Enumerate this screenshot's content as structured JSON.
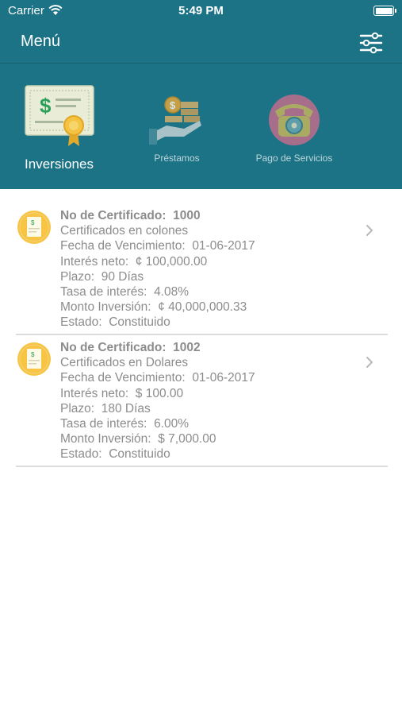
{
  "status_bar": {
    "carrier": "Carrier",
    "time": "5:49 PM"
  },
  "nav": {
    "title": "Menú"
  },
  "tabs": [
    {
      "label": "Inversiones",
      "icon": "certificate-icon",
      "active": true
    },
    {
      "label": "Préstamos",
      "icon": "money-hand-icon",
      "active": false
    },
    {
      "label": "Pago de Servicios",
      "icon": "telephone-icon",
      "active": false
    }
  ],
  "certificates": [
    {
      "number_label": "No de Certificado:",
      "number": "1000",
      "type": "Certificados en colones",
      "due_label": "Fecha de Vencimiento:",
      "due": "01-06-2017",
      "interest_label": "Interés neto:",
      "interest": "¢ 100,000.00",
      "term_label": "Plazo:",
      "term": "90  Días",
      "rate_label": "Tasa de interés:",
      "rate": "4.08%",
      "amount_label": "Monto Inversión:",
      "amount": "¢ 40,000,000.33",
      "status_label": "Estado:",
      "status": "Constituido"
    },
    {
      "number_label": "No de Certificado:",
      "number": "1002",
      "type": "Certificados en Dolares",
      "due_label": "Fecha de Vencimiento:",
      "due": "01-06-2017",
      "interest_label": "Interés neto:",
      "interest": "$ 100.00",
      "term_label": "Plazo:",
      "term": "180  Días",
      "rate_label": "Tasa de interés:",
      "rate": "6.00%",
      "amount_label": "Monto Inversión:",
      "amount": "$ 7,000.00",
      "status_label": "Estado:",
      "status": "Constituido"
    }
  ],
  "colors": {
    "header": "#1d7386",
    "text_gray": "#8c8c8c",
    "icon_yellow": "#f8c443"
  }
}
